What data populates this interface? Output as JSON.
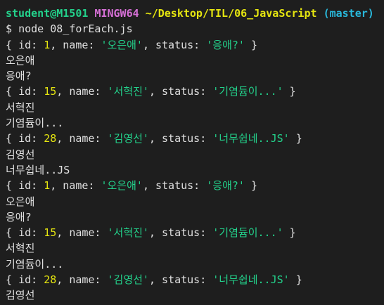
{
  "prompt": {
    "user_host": "student@M1501",
    "system": "MINGW64",
    "path": "~/Desktop/TIL/06_JavaScript",
    "branch": "(master)"
  },
  "command": {
    "dollar": "$",
    "text": "node 08_forEach.js"
  },
  "labels": {
    "id_key": "id:",
    "name_key": "name:",
    "status_key": "status:"
  },
  "records": [
    {
      "id": "1",
      "name": "'오은애'",
      "status": "'응애?'",
      "name_out": "오은애",
      "status_out": "응애?"
    },
    {
      "id": "15",
      "name": "'서혁진'",
      "status": "'기염듐이...'",
      "name_out": "서혁진",
      "status_out": "기염듐이..."
    },
    {
      "id": "28",
      "name": "'김영선'",
      "status": "'너무쉽네..JS'",
      "name_out": "김영선",
      "status_out": "너무쉽네..JS"
    }
  ],
  "colors": {
    "background": "#1e1e1e",
    "user": "#23d18b",
    "system": "#d670d6",
    "path": "#e5e510",
    "branch": "#29b8db",
    "number": "#e5e510",
    "string": "#23d18b"
  }
}
